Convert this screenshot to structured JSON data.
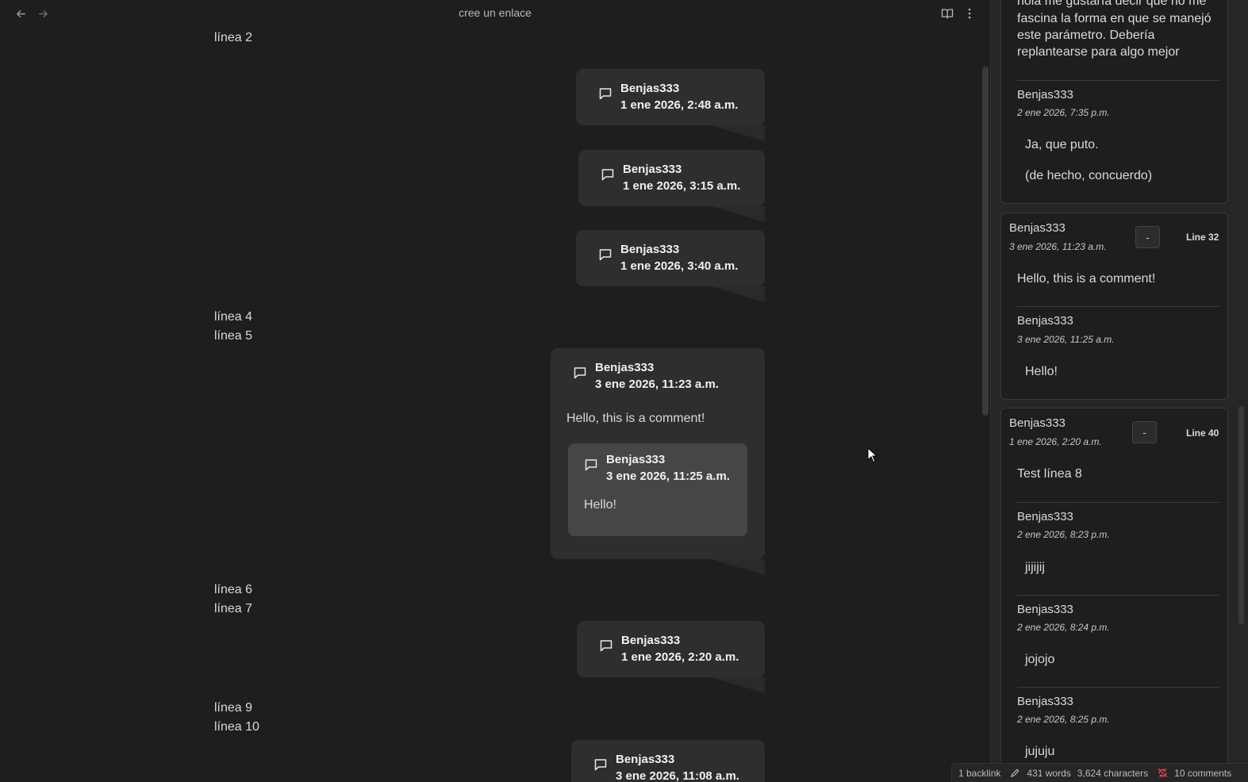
{
  "titlebar": {
    "title": "cree un enlace",
    "back_icon": "arrow-left-icon",
    "forward_icon": "arrow-right-icon",
    "reading_icon": "book-open-icon",
    "more_icon": "more-vertical-icon"
  },
  "lines": [
    "línea 2",
    "línea 4",
    "línea 5",
    "línea 6",
    "línea 7",
    "línea 9",
    "línea 10"
  ],
  "bubbles": [
    {
      "author": "Benjas333",
      "date": "1 ene 2026, 2:48 a.m."
    },
    {
      "author": "Benjas333",
      "date": "1 ene 2026, 3:15 a.m."
    },
    {
      "author": "Benjas333",
      "date": "1 ene 2026, 3:40 a.m."
    },
    {
      "author": "Benjas333",
      "date": "3 ene 2026, 11:23 a.m.",
      "text": "Hello, this is a comment!",
      "reply": {
        "author": "Benjas333",
        "date": "3 ene 2026, 11:25 a.m.",
        "text": "Hello!"
      }
    },
    {
      "author": "Benjas333",
      "date": "1 ene 2026, 2:20 a.m."
    },
    {
      "author": "Benjas333",
      "date": "3 ene 2026, 11:08 a.m."
    }
  ],
  "sidebar": {
    "card1": {
      "text_lines": [
        "hola me gustaría decir que no me",
        "fascina la forma en que se manejó",
        "este parámetro. Debería",
        "replantearse para algo mejor"
      ],
      "reply": {
        "author": "Benjas333",
        "date": "2 ene 2026, 7:35 p.m.",
        "text1": "Ja, que puto.",
        "text2": "(de hecho, concuerdo)"
      }
    },
    "card2": {
      "author": "Benjas333",
      "date": "3 ene 2026, 11:23 a.m.",
      "collapse": "-",
      "line": "Line 32",
      "text": "Hello, this is a comment!",
      "reply": {
        "author": "Benjas333",
        "date": "3 ene 2026, 11:25 a.m.",
        "text": "Hello!"
      }
    },
    "card3": {
      "author": "Benjas333",
      "date": "1 ene 2026, 2:20 a.m.",
      "collapse": "-",
      "line": "Line 40",
      "text": "Test línea 8",
      "replies": [
        {
          "author": "Benjas333",
          "date": "2 ene 2026, 8:23 p.m.",
          "text": "jijijij"
        },
        {
          "author": "Benjas333",
          "date": "2 ene 2026, 8:24 p.m.",
          "text": "jojojo"
        },
        {
          "author": "Benjas333",
          "date": "2 ene 2026, 8:25 p.m.",
          "text": "jujuju"
        }
      ]
    }
  },
  "statusbar": {
    "backlinks": "1 backlink",
    "words": "431 words",
    "characters": "3,624 characters",
    "comments": "10 comments"
  },
  "colors": {
    "background": "#1e1e1e",
    "bubble": "#2e2e2e",
    "reply_bubble": "#464646",
    "sidebar": "#262626",
    "sync_icon": "#e5484d"
  }
}
